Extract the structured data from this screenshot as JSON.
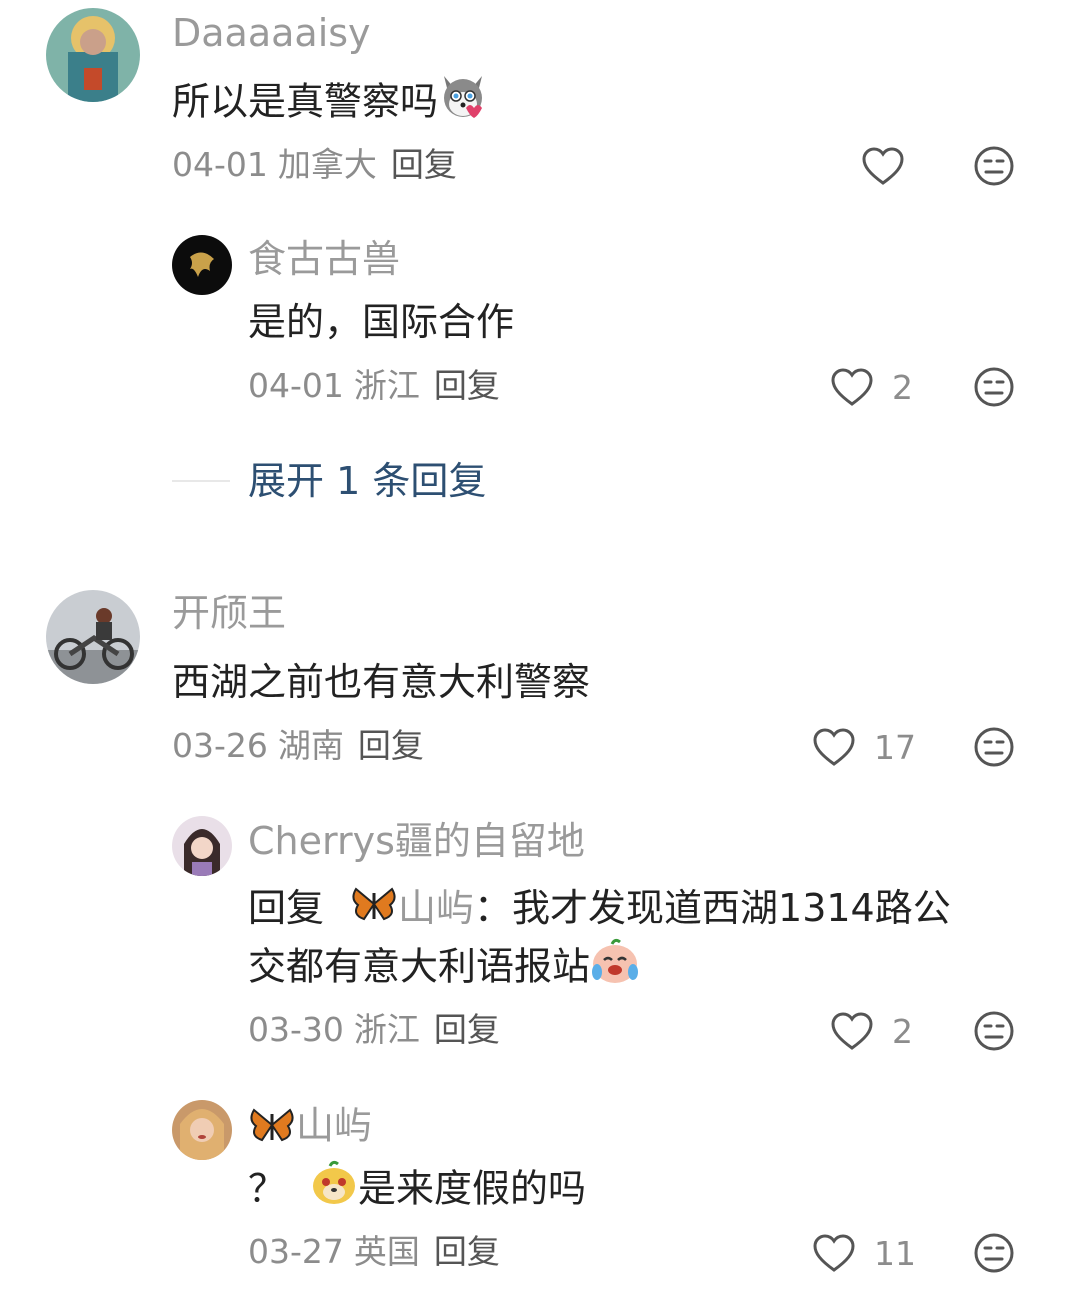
{
  "comments": [
    {
      "username": "Daaaaaisy",
      "text": "所以是真警察吗",
      "date": "04-01",
      "location": "加拿大",
      "reply_label": "回复",
      "likes": ""
    },
    {
      "username": "食古古兽",
      "text": "是的，国际合作",
      "date": "04-01",
      "location": "浙江",
      "reply_label": "回复",
      "likes": "2"
    },
    {
      "username": "开颀王",
      "text": "西湖之前也有意大利警察",
      "date": "03-26",
      "location": "湖南",
      "reply_label": "回复",
      "likes": "17"
    },
    {
      "username": "Cherrys疆的自留地",
      "text_prefix": "回复",
      "text_mention": "山屿",
      "text_line1": "：我才发现道西湖1314路公",
      "text_line2": "交都有意大利语报站",
      "date": "03-30",
      "location": "浙江",
      "reply_label": "回复",
      "likes": "2"
    },
    {
      "username": "山屿",
      "text_prefix": "？",
      "text": "是来度假的吗",
      "date": "03-27",
      "location": "英国",
      "reply_label": "回复",
      "likes": "11"
    }
  ],
  "expand_replies": "展开 1 条回复",
  "icons": {
    "like": "heart-outline-icon",
    "dislike": "neutral-face-icon"
  }
}
